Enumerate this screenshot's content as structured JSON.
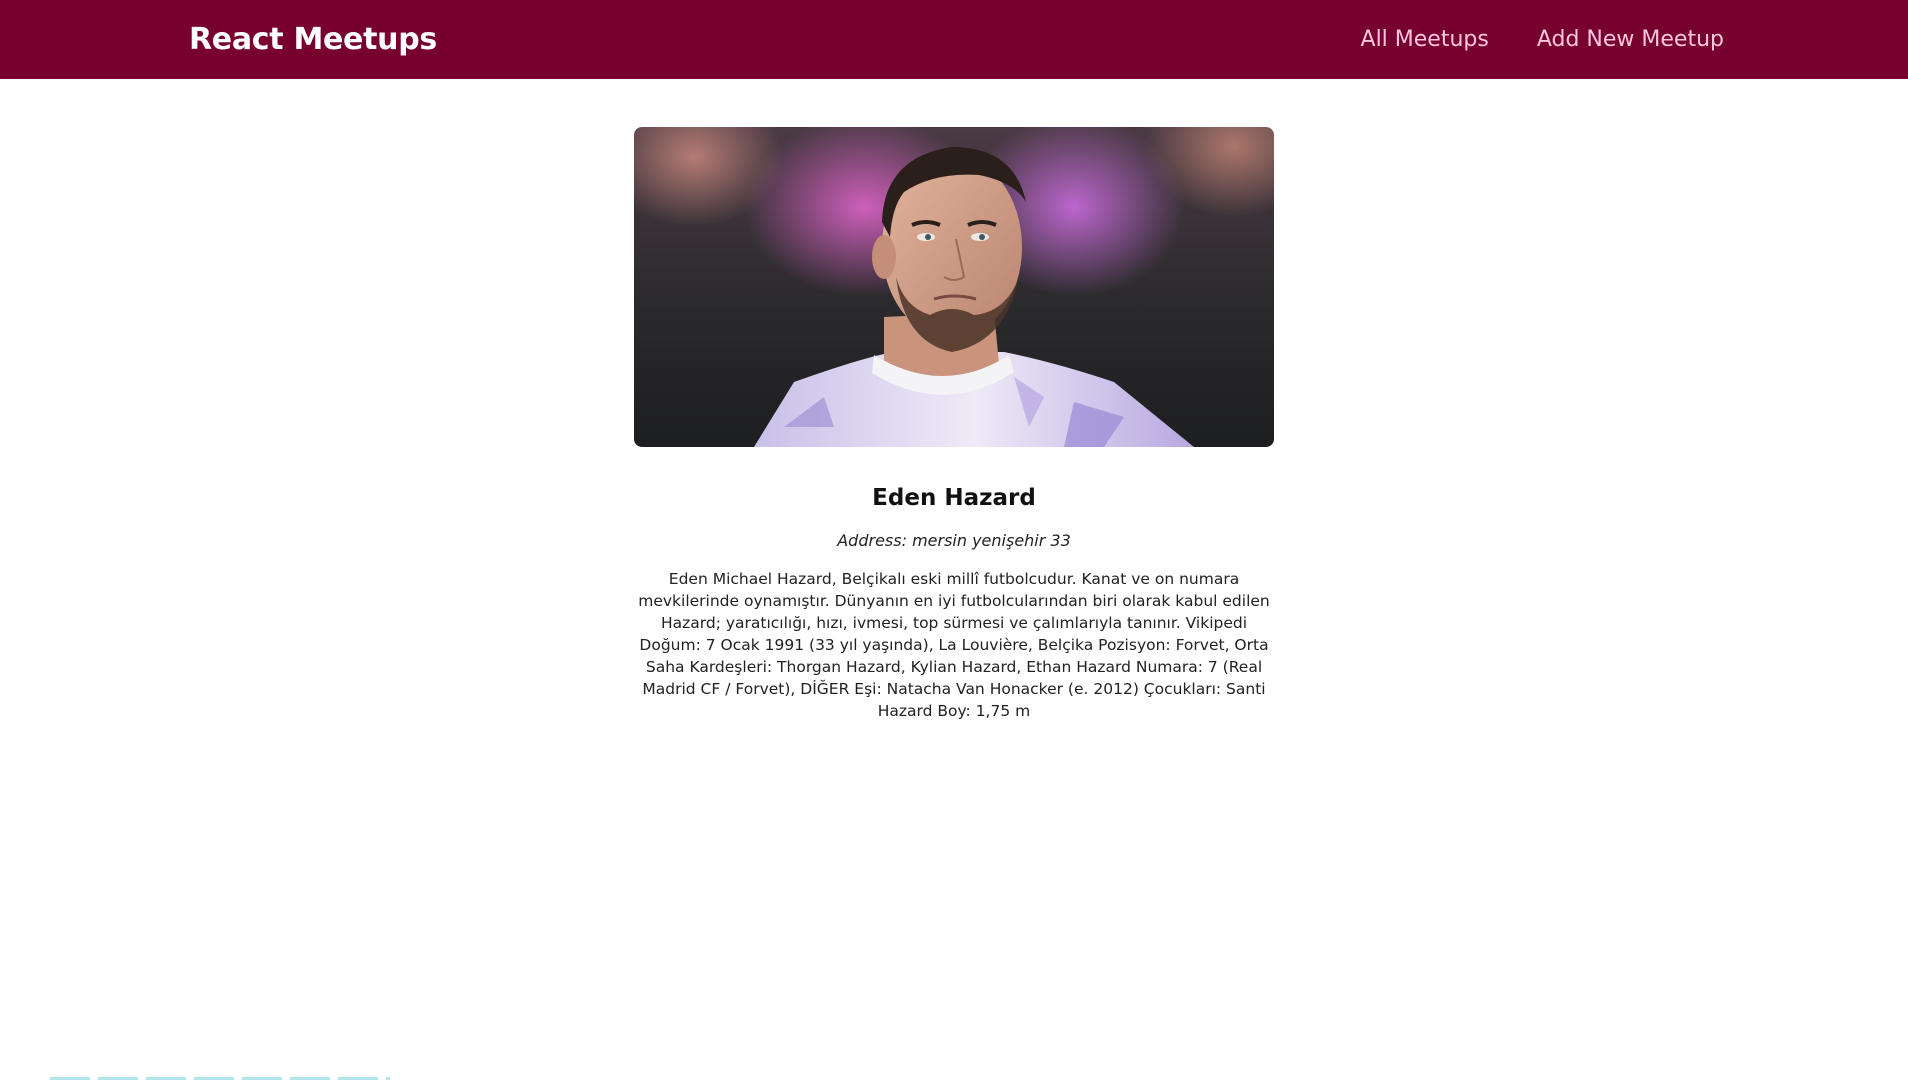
{
  "header": {
    "logo": "React Meetups",
    "nav": [
      {
        "label": "All Meetups"
      },
      {
        "label": "Add New Meetup"
      }
    ]
  },
  "meetup": {
    "image_alt": "Eden Hazard",
    "title": "Eden Hazard",
    "address": "Address: mersin yenişehir 33",
    "description": "Eden Michael Hazard, Belçikalı eski millî futbolcudur. Kanat ve on numara mevkilerinde oynamıştır. Dünyanın en iyi futbolcularından biri olarak kabul edilen Hazard; yaratıcılığı, hızı, ivmesi, top sürmesi ve çalımlarıyla tanınır. Vikipedi Doğum: 7 Ocak 1991 (33 yıl yaşında), La Louvière, Belçika Pozisyon: Forvet, Orta Saha Kardeşleri: Thorgan Hazard, Kylian Hazard, Ethan Hazard Numara: 7 (Real Madrid CF / Forvet), DİĞER Eşi: Natacha Van Honacker (e. 2012) Çocukları: Santi Hazard Boy: 1,75 m"
  },
  "colors": {
    "header_bg": "#77002e",
    "nav_link": "#fcc5e0",
    "logo": "#ffffff"
  }
}
